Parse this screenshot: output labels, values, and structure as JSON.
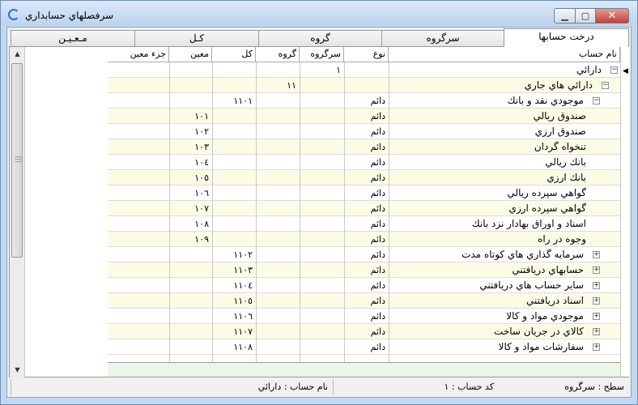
{
  "window": {
    "title": "سرفصلهاي حسابداري"
  },
  "tabs": [
    "درخت حسابها",
    "سرگروه",
    "گروه",
    "كـل",
    "مـعـيـن"
  ],
  "columns": {
    "name": "نام حساب",
    "type": "نوع",
    "sargroup": "سرگروه",
    "group": "گروه",
    "kol": "كل",
    "moin": "معين",
    "joz": "جزء معين"
  },
  "rows": [
    {
      "name": "دارائي",
      "type": "",
      "sargroup": "١",
      "group": "",
      "kol": "",
      "moin": "",
      "joz": ""
    },
    {
      "name": "دارائي هاي جاري",
      "type": "",
      "sargroup": "",
      "group": "١١",
      "kol": "",
      "moin": "",
      "joz": ""
    },
    {
      "name": "موجودي نقد و بانك",
      "type": "دائم",
      "sargroup": "",
      "group": "",
      "kol": "١١٠١",
      "moin": "",
      "joz": ""
    },
    {
      "name": "صندوق ريالي",
      "type": "دائم",
      "sargroup": "",
      "group": "",
      "kol": "",
      "moin": "١٠١",
      "joz": ""
    },
    {
      "name": "صندوق ارزي",
      "type": "دائم",
      "sargroup": "",
      "group": "",
      "kol": "",
      "moin": "١٠٢",
      "joz": ""
    },
    {
      "name": "تنخواه گردان",
      "type": "دائم",
      "sargroup": "",
      "group": "",
      "kol": "",
      "moin": "١٠٣",
      "joz": ""
    },
    {
      "name": "بانك ريالي",
      "type": "دائم",
      "sargroup": "",
      "group": "",
      "kol": "",
      "moin": "١٠٤",
      "joz": ""
    },
    {
      "name": "بانك ارزي",
      "type": "دائم",
      "sargroup": "",
      "group": "",
      "kol": "",
      "moin": "١٠٥",
      "joz": ""
    },
    {
      "name": "گواهي سپرده ريالي",
      "type": "دائم",
      "sargroup": "",
      "group": "",
      "kol": "",
      "moin": "١٠٦",
      "joz": ""
    },
    {
      "name": "گواهي سپرده ارزي",
      "type": "دائم",
      "sargroup": "",
      "group": "",
      "kol": "",
      "moin": "١٠٧",
      "joz": ""
    },
    {
      "name": "اسناد و اوراق بهادار نزد بانك",
      "type": "دائم",
      "sargroup": "",
      "group": "",
      "kol": "",
      "moin": "١٠٨",
      "joz": ""
    },
    {
      "name": "وجوه در راه",
      "type": "دائم",
      "sargroup": "",
      "group": "",
      "kol": "",
      "moin": "١٠٩",
      "joz": ""
    },
    {
      "name": "سرمايه گذاري هاي كوتاه مدت",
      "type": "دائم",
      "sargroup": "",
      "group": "",
      "kol": "١١٠٢",
      "moin": "",
      "joz": ""
    },
    {
      "name": "حسابهاي دريافتني",
      "type": "دائم",
      "sargroup": "",
      "group": "",
      "kol": "١١٠٣",
      "moin": "",
      "joz": ""
    },
    {
      "name": "ساير حساب هاي دريافتني",
      "type": "دائم",
      "sargroup": "",
      "group": "",
      "kol": "١١٠٤",
      "moin": "",
      "joz": ""
    },
    {
      "name": "اسناد دريافتني",
      "type": "دائم",
      "sargroup": "",
      "group": "",
      "kol": "١١٠٥",
      "moin": "",
      "joz": ""
    },
    {
      "name": "موجودي مواد و كالا",
      "type": "دائم",
      "sargroup": "",
      "group": "",
      "kol": "١١٠٦",
      "moin": "",
      "joz": ""
    },
    {
      "name": "كالاي در جريان ساخت",
      "type": "دائم",
      "sargroup": "",
      "group": "",
      "kol": "١١٠٧",
      "moin": "",
      "joz": ""
    },
    {
      "name": "سفارشات مواد و كالا",
      "type": "دائم",
      "sargroup": "",
      "group": "",
      "kol": "١١٠٨",
      "moin": "",
      "joz": ""
    }
  ],
  "status": {
    "level": "سطح : سرگروه",
    "code": "كد حساب : ١",
    "account_name": "نام حساب : دارائي"
  }
}
